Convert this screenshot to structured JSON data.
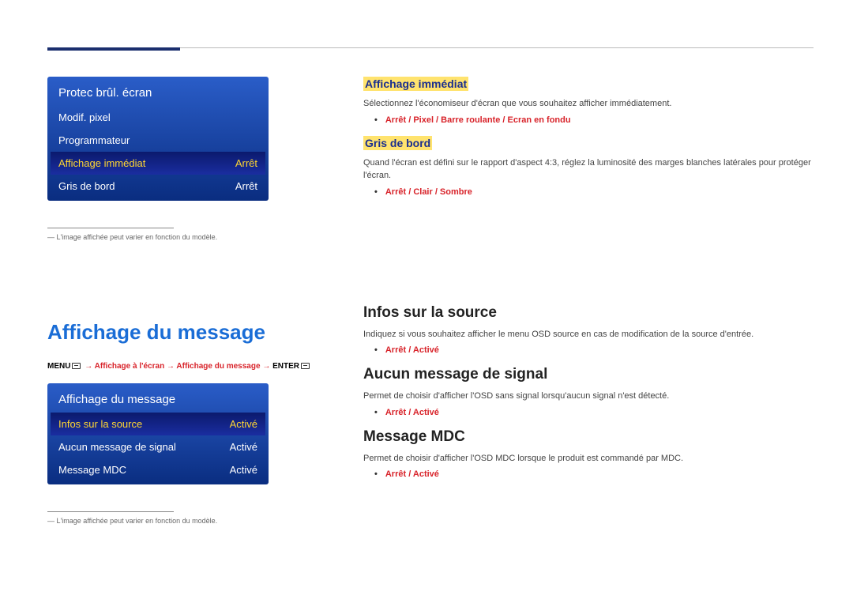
{
  "panel1": {
    "title": "Protec brûl. écran",
    "rows": [
      {
        "label": "Modif. pixel",
        "value": ""
      },
      {
        "label": "Programmateur",
        "value": ""
      },
      {
        "label": "Affichage immédiat",
        "value": "Arrêt",
        "selected": true
      },
      {
        "label": "Gris de bord",
        "value": "Arrêt"
      }
    ]
  },
  "note1": "― L'image affichée peut varier en fonction du modèle.",
  "note2": "― L'image affichée peut varier en fonction du modèle.",
  "sections": {
    "immediate": {
      "heading": "Affichage immédiat",
      "desc": "Sélectionnez l'économiseur d'écran que vous souhaitez afficher immédiatement.",
      "options": "Arrêt / Pixel / Barre roulante / Ecran en fondu"
    },
    "sidegray": {
      "heading": "Gris de bord",
      "desc": "Quand l'écran est défini sur le rapport d'aspect 4:3, réglez la luminosité des marges blanches latérales pour protéger l'écran.",
      "options": "Arrêt / Clair / Sombre"
    },
    "msgdisplay": {
      "heading": "Affichage du message"
    },
    "breadcrumb": {
      "menu": "MENU",
      "path1": "Affichage à l'écran",
      "path2": "Affichage du message",
      "enter": "ENTER"
    },
    "source": {
      "heading": "Infos sur la source",
      "desc": "Indiquez si vous souhaitez afficher le menu OSD source en cas de modification de la source d'entrée.",
      "options": "Arrêt / Activé"
    },
    "nosignal": {
      "heading": "Aucun message de signal",
      "desc": "Permet de choisir d'afficher l'OSD sans signal lorsqu'aucun signal n'est détecté.",
      "options": "Arrêt / Activé"
    },
    "mdc": {
      "heading": "Message MDC",
      "desc": "Permet de choisir d'afficher l'OSD MDC lorsque le produit est commandé par MDC.",
      "options": "Arrêt / Activé"
    }
  },
  "panel2": {
    "title": "Affichage du message",
    "rows": [
      {
        "label": "Infos sur la source",
        "value": "Activé",
        "selected": true
      },
      {
        "label": "Aucun message de signal",
        "value": "Activé"
      },
      {
        "label": "Message MDC",
        "value": "Activé"
      }
    ]
  }
}
